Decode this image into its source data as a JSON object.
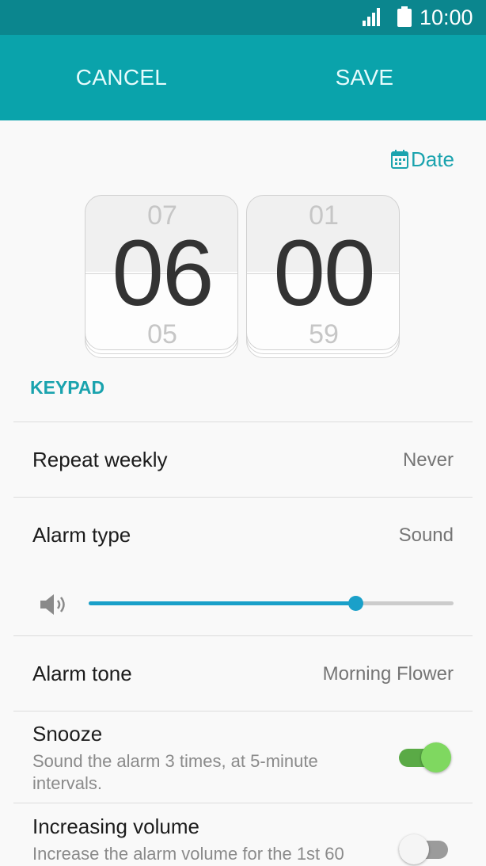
{
  "status_bar": {
    "time": "10:00",
    "signal_icon": "cell-signal-icon",
    "battery_icon": "battery-icon"
  },
  "action_bar": {
    "cancel_label": "CANCEL",
    "save_label": "SAVE"
  },
  "date_link": {
    "label": "Date",
    "icon": "calendar-icon"
  },
  "time_picker": {
    "hour": {
      "prev": "07",
      "current": "06",
      "next": "05"
    },
    "minute": {
      "prev": "01",
      "current": "00",
      "next": "59"
    }
  },
  "keypad_label": "KEYPAD",
  "settings": {
    "repeat_weekly": {
      "label": "Repeat weekly",
      "value": "Never"
    },
    "alarm_type": {
      "label": "Alarm type",
      "value": "Sound"
    },
    "volume": {
      "icon": "speaker-icon",
      "level": 0.73
    },
    "alarm_tone": {
      "label": "Alarm tone",
      "value": "Morning Flower"
    },
    "snooze": {
      "label": "Snooze",
      "description": "Sound the alarm 3 times, at 5-minute intervals.",
      "enabled": true
    },
    "increasing_volume": {
      "label": "Increasing volume",
      "description": "Increase the alarm volume for the 1st 60",
      "enabled": false
    }
  },
  "colors": {
    "status_bar": "#0b868e",
    "action_bar": "#0aa3ab",
    "accent": "#1aa3ae",
    "slider": "#1aa0c9",
    "toggle_on": "#7fd860"
  }
}
